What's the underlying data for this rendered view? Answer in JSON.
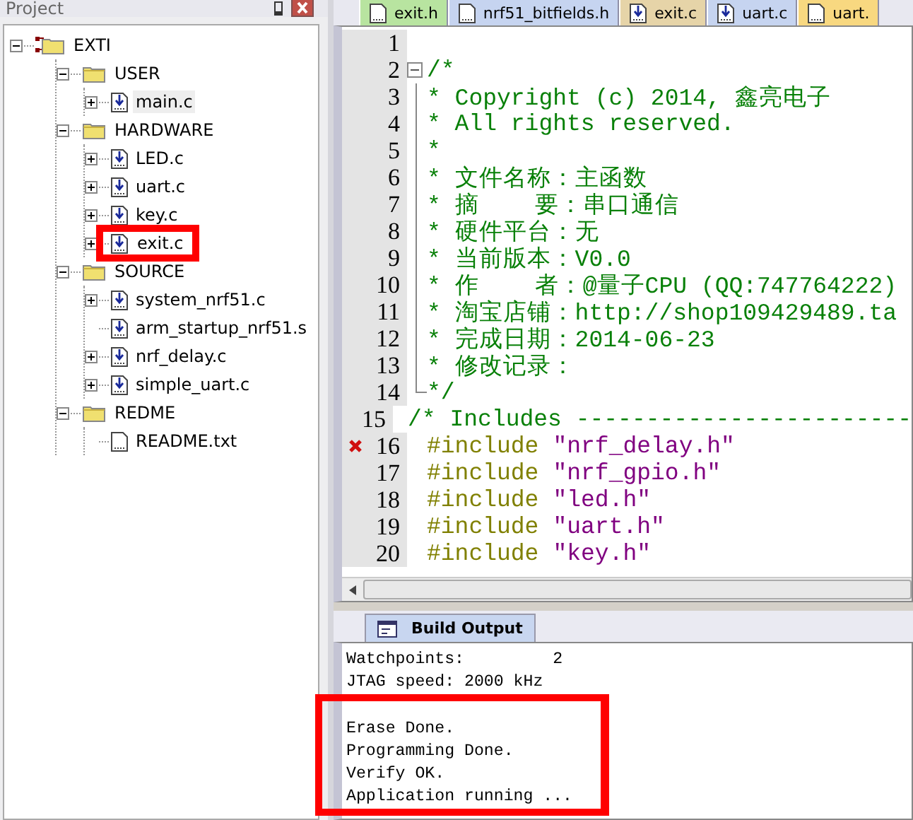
{
  "project_panel": {
    "title": "Project",
    "tree": [
      {
        "label": "EXTI",
        "kind": "root",
        "expanded": true,
        "selected": false,
        "annotated": false,
        "children": [
          {
            "label": "USER",
            "kind": "folder",
            "expanded": true,
            "selected": false,
            "annotated": false,
            "children": [
              {
                "label": "main.c",
                "kind": "source",
                "selected": true,
                "annotated": false
              }
            ]
          },
          {
            "label": "HARDWARE",
            "kind": "folder",
            "expanded": true,
            "selected": false,
            "annotated": false,
            "children": [
              {
                "label": "LED.c",
                "kind": "source",
                "selected": false,
                "annotated": false
              },
              {
                "label": "uart.c",
                "kind": "source",
                "selected": false,
                "annotated": false
              },
              {
                "label": "key.c",
                "kind": "source",
                "selected": false,
                "annotated": false
              },
              {
                "label": "exit.c",
                "kind": "source",
                "selected": false,
                "annotated": true
              }
            ]
          },
          {
            "label": "SOURCE",
            "kind": "folder",
            "expanded": true,
            "selected": false,
            "annotated": false,
            "children": [
              {
                "label": "system_nrf51.c",
                "kind": "source",
                "selected": false,
                "annotated": false
              },
              {
                "label": "arm_startup_nrf51.s",
                "kind": "asm",
                "selected": false,
                "annotated": false
              },
              {
                "label": "nrf_delay.c",
                "kind": "source",
                "selected": false,
                "annotated": false
              },
              {
                "label": "simple_uart.c",
                "kind": "source",
                "selected": false,
                "annotated": false
              }
            ]
          },
          {
            "label": "REDME",
            "kind": "folder",
            "expanded": true,
            "selected": false,
            "annotated": false,
            "children": [
              {
                "label": "README.txt",
                "kind": "text",
                "selected": false,
                "annotated": false
              }
            ]
          }
        ]
      }
    ]
  },
  "editor_tabs": [
    {
      "label": "exit.h",
      "kind": "header",
      "color": "#b8e4a0"
    },
    {
      "label": "nrf51_bitfields.h",
      "kind": "header",
      "color": "#c6d4f0"
    },
    {
      "label": "exit.c",
      "kind": "source",
      "color": "#e6d4a8"
    },
    {
      "label": "uart.c",
      "kind": "source",
      "color": "#c6d4f0"
    },
    {
      "label": "uart.",
      "kind": "header",
      "color": "#f8d880"
    }
  ],
  "code_lines": [
    {
      "number": "1",
      "error": false,
      "kind": "plain"
    },
    {
      "number": "2",
      "error": false,
      "kind": "foldstart",
      "segments": [
        {
          "kind": "comment",
          "text": "/*"
        }
      ]
    },
    {
      "number": "3",
      "error": false,
      "kind": "foldbody",
      "segments": [
        {
          "kind": "comment",
          "text": "* Copyright (c) 2014, 鑫亮电子"
        }
      ]
    },
    {
      "number": "4",
      "error": false,
      "kind": "foldbody",
      "segments": [
        {
          "kind": "comment",
          "text": "* All rights reserved."
        }
      ]
    },
    {
      "number": "5",
      "error": false,
      "kind": "foldbody",
      "segments": [
        {
          "kind": "comment",
          "text": "*"
        }
      ]
    },
    {
      "number": "6",
      "error": false,
      "kind": "foldbody",
      "segments": [
        {
          "kind": "comment",
          "text": "* 文件名称：主函数"
        }
      ]
    },
    {
      "number": "7",
      "error": false,
      "kind": "foldbody",
      "segments": [
        {
          "kind": "comment",
          "text": "* 摘    要：串口通信"
        }
      ]
    },
    {
      "number": "8",
      "error": false,
      "kind": "foldbody",
      "segments": [
        {
          "kind": "comment",
          "text": "* 硬件平台：无"
        }
      ]
    },
    {
      "number": "9",
      "error": false,
      "kind": "foldbody",
      "segments": [
        {
          "kind": "comment",
          "text": "* 当前版本：V0.0"
        }
      ]
    },
    {
      "number": "10",
      "error": false,
      "kind": "foldbody",
      "segments": [
        {
          "kind": "comment",
          "text": "* 作    者：@量子CPU (QQ:747764222)"
        }
      ]
    },
    {
      "number": "11",
      "error": false,
      "kind": "foldbody",
      "segments": [
        {
          "kind": "comment",
          "text": "* 淘宝店铺：http://shop109429489.ta"
        }
      ]
    },
    {
      "number": "12",
      "error": false,
      "kind": "foldbody",
      "segments": [
        {
          "kind": "comment",
          "text": "* 完成日期：2014-06-23"
        }
      ]
    },
    {
      "number": "13",
      "error": false,
      "kind": "foldbody",
      "segments": [
        {
          "kind": "comment",
          "text": "* 修改记录："
        }
      ]
    },
    {
      "number": "14",
      "error": false,
      "kind": "foldend",
      "segments": [
        {
          "kind": "comment",
          "text": "*/"
        }
      ]
    },
    {
      "number": "15",
      "error": false,
      "kind": "plain",
      "segments": [
        {
          "kind": "comment",
          "text": "/* Includes ------------------------"
        }
      ]
    },
    {
      "number": "16",
      "error": true,
      "kind": "plain",
      "segments": [
        {
          "kind": "directive",
          "text": "#include"
        },
        {
          "kind": "string",
          "text": "\"nrf_delay.h\""
        }
      ]
    },
    {
      "number": "17",
      "error": false,
      "kind": "plain",
      "segments": [
        {
          "kind": "directive",
          "text": "#include"
        },
        {
          "kind": "string",
          "text": "\"nrf_gpio.h\""
        }
      ]
    },
    {
      "number": "18",
      "error": false,
      "kind": "plain",
      "segments": [
        {
          "kind": "directive",
          "text": "#include"
        },
        {
          "kind": "string",
          "text": "\"led.h\""
        }
      ]
    },
    {
      "number": "19",
      "error": false,
      "kind": "plain",
      "segments": [
        {
          "kind": "directive",
          "text": "#include"
        },
        {
          "kind": "string",
          "text": "\"uart.h\""
        }
      ]
    },
    {
      "number": "20",
      "error": false,
      "kind": "plain",
      "segments": [
        {
          "kind": "directive",
          "text": "#include"
        },
        {
          "kind": "string",
          "text": "\"key.h\""
        }
      ]
    }
  ],
  "output_panel": {
    "tab": "Build Output",
    "groups": [
      {
        "annotated": false,
        "lines": [
          "Watchpoints:         2",
          "JTAG speed: 2000 kHz"
        ]
      },
      {
        "annotated": true,
        "lines": [
          "Erase Done.",
          "Programming Done.",
          "Verify OK.",
          "Application running ..."
        ]
      }
    ]
  }
}
